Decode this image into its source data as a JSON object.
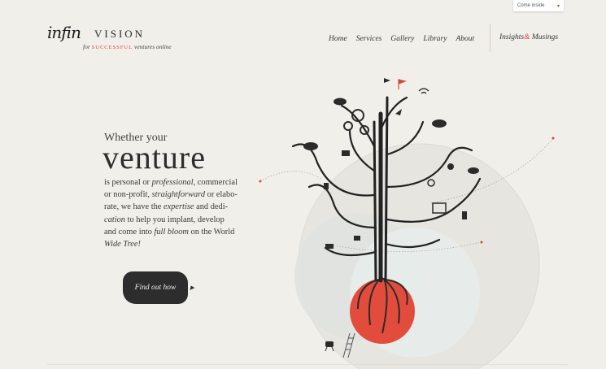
{
  "topbar": {
    "come_inside": "Come inside"
  },
  "logo": {
    "script": "infin",
    "word": "VISION",
    "tagline_pre": "for",
    "tagline_highlight": "SUCCESSFUL",
    "tagline_post": "ventures online"
  },
  "nav": {
    "items": [
      {
        "label": "Home"
      },
      {
        "label": "Services"
      },
      {
        "label": "Gallery"
      },
      {
        "label": "Library"
      },
      {
        "label": "About"
      }
    ],
    "insights_pre": "Insights",
    "insights_amp": "&",
    "insights_post": " Musings"
  },
  "hero": {
    "intro": "Whether your",
    "title": "venture",
    "lines": [
      [
        {
          "t": "is personal or "
        },
        {
          "t": "professional",
          "i": true
        },
        {
          "t": ", commercial"
        }
      ],
      [
        {
          "t": "or non-profit, "
        },
        {
          "t": "straightforward",
          "i": true
        },
        {
          "t": " or elabo-"
        }
      ],
      [
        {
          "t": "rate, we have the "
        },
        {
          "t": "expertise",
          "i": true
        },
        {
          "t": " and dedi-"
        }
      ],
      [
        {
          "t": "cation",
          "i": true
        },
        {
          "t": " to help you implant, develop"
        }
      ],
      [
        {
          "t": "and come into "
        },
        {
          "t": "full bloom",
          "i": true
        },
        {
          "t": " on the World"
        }
      ],
      [
        {
          "t": "Wide Tree!",
          "i": true
        }
      ]
    ],
    "button_label": "Find out how"
  },
  "colors": {
    "background": "#f1efe9",
    "accent_red": "#d04a3a",
    "dark": "#2d2d2d"
  }
}
